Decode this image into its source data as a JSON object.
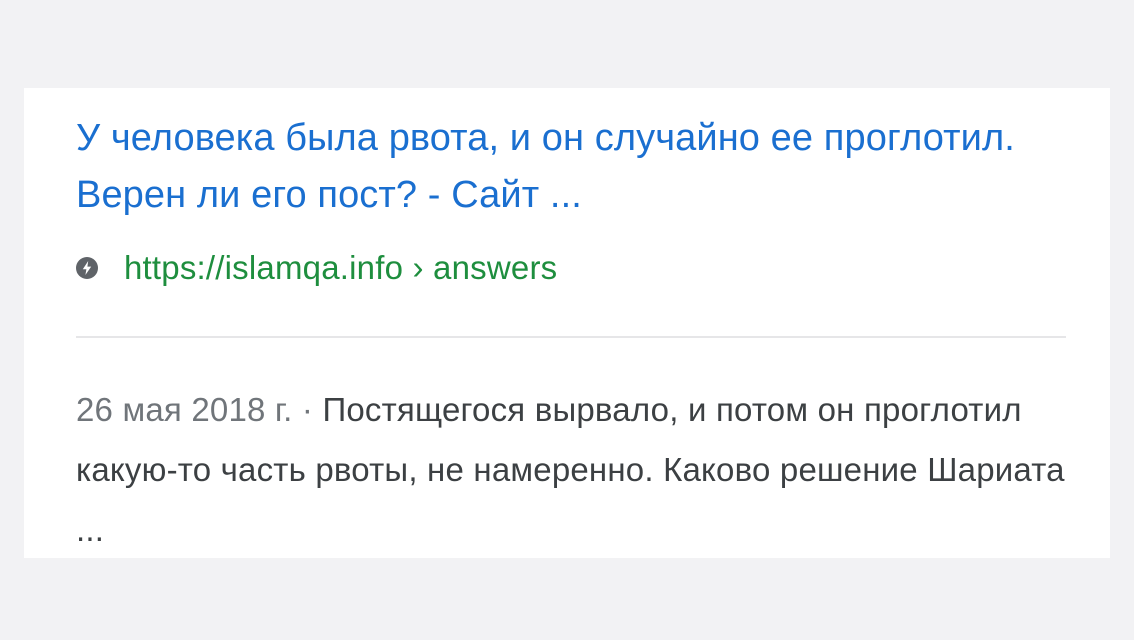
{
  "result": {
    "title": "У человека была рвота, и он случайно ее проглотил. Верен ли его пост? - Сайт ...",
    "amp_icon": "amp-lightning-icon",
    "url": "https://islamqa.info › answers",
    "date": "26 мая 2018 г. · ",
    "snippet": "Постящегося вырвало, и потом он проглотил какую-то часть рвоты, не намеренно. Каково решение Шариата ..."
  },
  "colors": {
    "title": "#1a6fd0",
    "url": "#1e8e3e",
    "snippet": "#3c4043",
    "date": "#70757a",
    "background": "#f2f2f4",
    "card": "#ffffff"
  }
}
